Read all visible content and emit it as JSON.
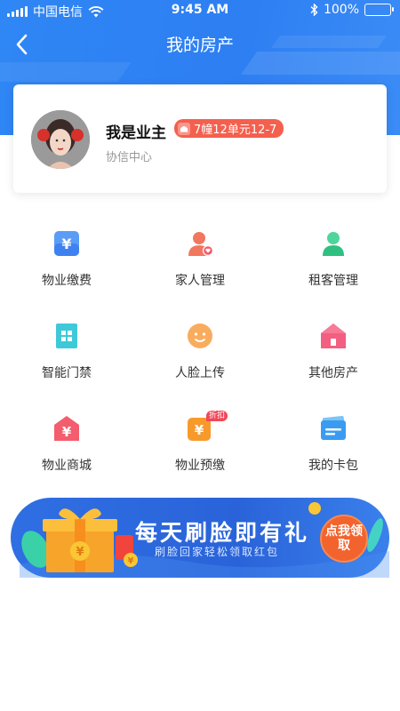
{
  "status": {
    "carrier": "中国电信",
    "time": "9:45 AM",
    "battery": "100%"
  },
  "nav": {
    "title": "我的房产"
  },
  "profile": {
    "name": "我是业主",
    "room": "7幢12单元12-7",
    "community": "协信中心"
  },
  "menu": [
    {
      "label": "物业缴费",
      "icon": "property-payment-icon",
      "color": "#4a8ff5"
    },
    {
      "label": "家人管理",
      "icon": "family-management-icon",
      "color": "#f26a58"
    },
    {
      "label": "租客管理",
      "icon": "tenant-management-icon",
      "color": "#3ccf8e"
    },
    {
      "label": "智能门禁",
      "icon": "smart-access-icon",
      "color": "#33c4d6"
    },
    {
      "label": "人脸上传",
      "icon": "face-upload-icon",
      "color": "#f7a24f"
    },
    {
      "label": "其他房产",
      "icon": "other-property-icon",
      "color": "#f0577a"
    },
    {
      "label": "物业商城",
      "icon": "property-mall-icon",
      "color": "#f45d6e"
    },
    {
      "label": "物业预缴",
      "icon": "property-prepay-icon",
      "color": "#f79a2b",
      "badge": "折扣"
    },
    {
      "label": "我的卡包",
      "icon": "card-wallet-icon",
      "color": "#3a9cf0"
    }
  ],
  "banner": {
    "title": "每天刷脸即有礼",
    "subtitle": "刷脸回家轻松领取红包",
    "button": "点我领取"
  }
}
